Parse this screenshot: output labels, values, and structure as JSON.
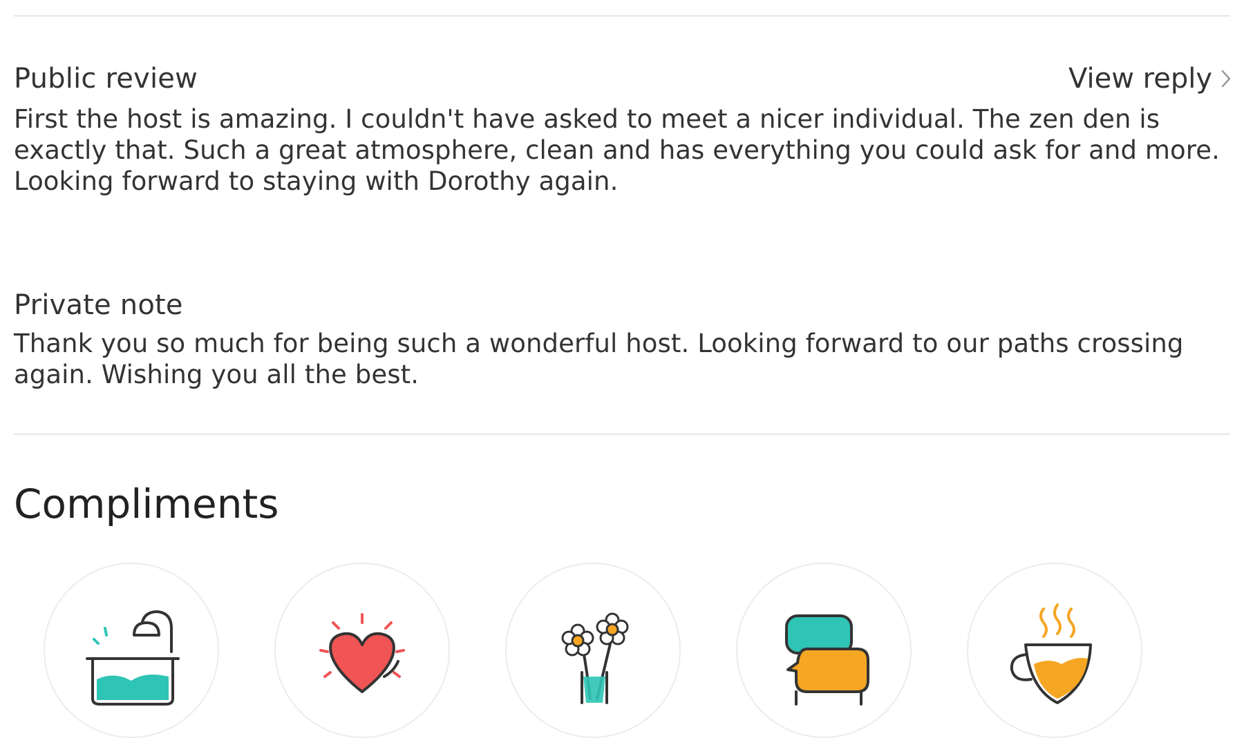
{
  "public_review": {
    "label": "Public review",
    "view_reply_label": "View reply",
    "text": "First the host is amazing. I couldn't have asked to meet a nicer individual. The zen den is exactly that. Such a great atmosphere, clean and has everything you could ask for and more. Looking forward to staying with Dorothy again."
  },
  "private_note": {
    "label": "Private note",
    "text": "Thank you so much for being such a wonderful host. Looking forward to our paths crossing again. Wishing you all the best."
  },
  "compliments": {
    "heading": "Compliments",
    "items": [
      {
        "icon": "bathtub-icon"
      },
      {
        "icon": "heart-icon"
      },
      {
        "icon": "flowers-icon"
      },
      {
        "icon": "speech-bubbles-icon"
      },
      {
        "icon": "tea-cup-icon"
      }
    ]
  },
  "colors": {
    "teal": "#2ec4b6",
    "red": "#f05454",
    "orange": "#f5a623",
    "outline": "#333333",
    "divider": "#e6e6e6"
  }
}
